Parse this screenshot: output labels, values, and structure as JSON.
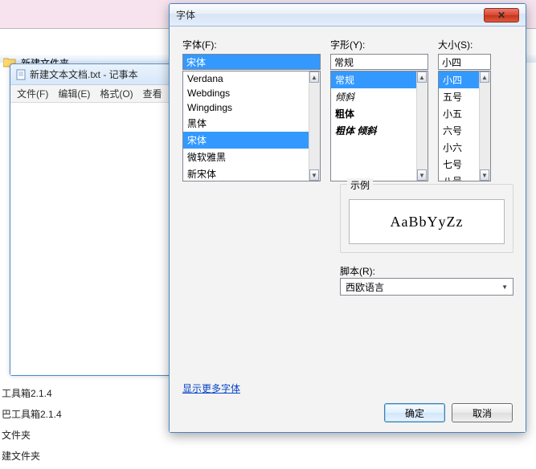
{
  "background": {
    "folder_name": "新建文件夹",
    "side_labels": [
      "工具箱2.1.4",
      "巴工具箱2.1.4",
      "文件夹",
      "建文件夹"
    ]
  },
  "notepad": {
    "title": "新建文本文档.txt - 记事本",
    "menu": {
      "file": "文件(F)",
      "edit": "编辑(E)",
      "format": "格式(O)",
      "view": "查看"
    }
  },
  "dialog": {
    "title": "字体",
    "close": "✕",
    "font_label": "字体(F):",
    "font_value": "宋体",
    "font_list": [
      "Verdana",
      "Webdings",
      "Wingdings",
      "黑体",
      "宋体",
      "微软雅黑",
      "新宋体"
    ],
    "font_selected": "宋体",
    "style_label": "字形(Y):",
    "style_value": "常规",
    "style_list": [
      {
        "label": "常规",
        "class": ""
      },
      {
        "label": "倾斜",
        "class": "italic"
      },
      {
        "label": "粗体",
        "class": "bold"
      },
      {
        "label": "粗体 倾斜",
        "class": "bolditalic"
      }
    ],
    "style_selected": "常规",
    "size_label": "大小(S):",
    "size_value": "小四",
    "size_list": [
      "小四",
      "五号",
      "小五",
      "六号",
      "小六",
      "七号",
      "八号"
    ],
    "size_selected": "小四",
    "sample_label": "示例",
    "sample_text": "AaBbYyZz",
    "script_label": "脚本(R):",
    "script_value": "西欧语言",
    "more_fonts": "显示更多字体",
    "ok": "确定",
    "cancel": "取消"
  }
}
